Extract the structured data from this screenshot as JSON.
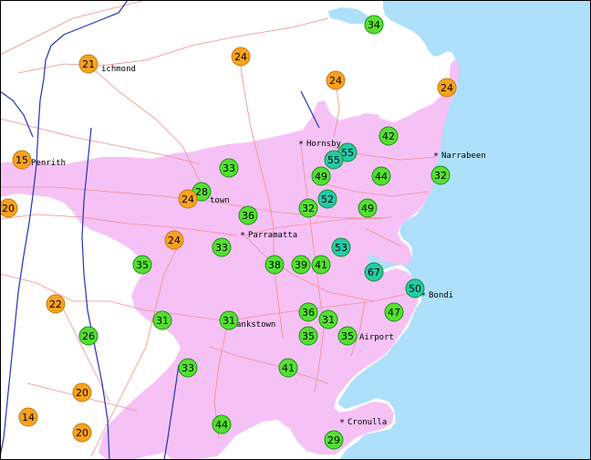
{
  "colors": {
    "sea": "#aee0fb",
    "urban": "#f6c2f6",
    "road": "#f28c8c",
    "river": "#2233bb",
    "green_marker": "#55e030",
    "orange_marker": "#f9a21e",
    "teal_marker": "#22ccaa",
    "marker_stroke": "#1a8c1a"
  },
  "places": [
    {
      "name": "Richmond",
      "label": "ichmond"
    },
    {
      "name": "Penrith",
      "label": "Penrith"
    },
    {
      "name": "Blacktown",
      "label": "town"
    },
    {
      "name": "Parramatta",
      "label": "Parramatta"
    },
    {
      "name": "Hornsby",
      "label": "Hornsby"
    },
    {
      "name": "Narrabeen",
      "label": "Narrabeen"
    },
    {
      "name": "Bondi",
      "label": "Bondi"
    },
    {
      "name": "Bankstown",
      "label": "ankstown"
    },
    {
      "name": "Airport",
      "label": "Airport"
    },
    {
      "name": "Cronulla",
      "label": "Cronulla"
    }
  ],
  "readings": [
    {
      "value": "34",
      "category": "green"
    },
    {
      "value": "21",
      "category": "orange"
    },
    {
      "value": "24",
      "category": "orange"
    },
    {
      "value": "24",
      "category": "orange"
    },
    {
      "value": "24",
      "category": "orange"
    },
    {
      "value": "15",
      "category": "orange"
    },
    {
      "value": "42",
      "category": "green"
    },
    {
      "value": "55",
      "category": "teal"
    },
    {
      "value": "55",
      "category": "teal"
    },
    {
      "value": "33",
      "category": "green"
    },
    {
      "value": "49",
      "category": "green"
    },
    {
      "value": "44",
      "category": "green"
    },
    {
      "value": "32",
      "category": "green"
    },
    {
      "value": "20",
      "category": "orange"
    },
    {
      "value": "28",
      "category": "green"
    },
    {
      "value": "24",
      "category": "orange"
    },
    {
      "value": "36",
      "category": "green"
    },
    {
      "value": "32",
      "category": "green"
    },
    {
      "value": "52",
      "category": "teal"
    },
    {
      "value": "49",
      "category": "green"
    },
    {
      "value": "24",
      "category": "orange"
    },
    {
      "value": "33",
      "category": "green"
    },
    {
      "value": "53",
      "category": "teal"
    },
    {
      "value": "35",
      "category": "green"
    },
    {
      "value": "38",
      "category": "green"
    },
    {
      "value": "39",
      "category": "green"
    },
    {
      "value": "41",
      "category": "green"
    },
    {
      "value": "67",
      "category": "teal"
    },
    {
      "value": "50",
      "category": "teal"
    },
    {
      "value": "22",
      "category": "orange"
    },
    {
      "value": "47",
      "category": "green"
    },
    {
      "value": "31",
      "category": "green"
    },
    {
      "value": "31",
      "category": "green"
    },
    {
      "value": "36",
      "category": "green"
    },
    {
      "value": "31",
      "category": "green"
    },
    {
      "value": "26",
      "category": "green"
    },
    {
      "value": "35",
      "category": "green"
    },
    {
      "value": "35",
      "category": "green"
    },
    {
      "value": "33",
      "category": "green"
    },
    {
      "value": "41",
      "category": "green"
    },
    {
      "value": "20",
      "category": "orange"
    },
    {
      "value": "14",
      "category": "orange"
    },
    {
      "value": "44",
      "category": "green"
    },
    {
      "value": "20",
      "category": "orange"
    },
    {
      "value": "29",
      "category": "green"
    }
  ]
}
